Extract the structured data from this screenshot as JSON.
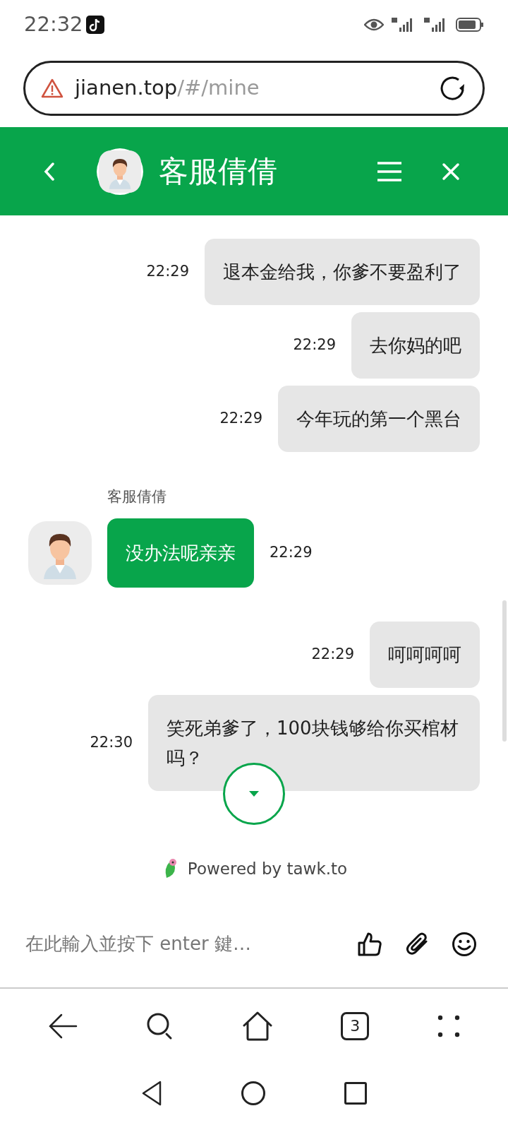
{
  "status_bar": {
    "time": "22:32"
  },
  "url_bar": {
    "domain": "jianen.top",
    "path": "/#/mine"
  },
  "chat_header": {
    "title": "客服倩倩"
  },
  "messages": [
    {
      "kind": "visitor",
      "text": "退本金给我，你爹不要盈利了",
      "time": "22:29"
    },
    {
      "kind": "visitor",
      "text": "去你妈的吧",
      "time": "22:29"
    },
    {
      "kind": "visitor",
      "text": "今年玩的第一个黑台",
      "time": "22:29"
    },
    {
      "kind": "agent",
      "sender": "客服倩倩",
      "text": "没办法呢亲亲",
      "time": "22:29"
    },
    {
      "kind": "visitor",
      "text": "呵呵呵呵",
      "time": "22:29"
    },
    {
      "kind": "visitor",
      "text": "笑死弟爹了，100块钱够给你买棺材吗？",
      "time": "22:30"
    }
  ],
  "footer": {
    "powered_by": "Powered by tawk.to"
  },
  "composer": {
    "placeholder": "在此輸入並按下 enter 鍵…"
  },
  "browser_nav": {
    "tab_count": "3"
  }
}
